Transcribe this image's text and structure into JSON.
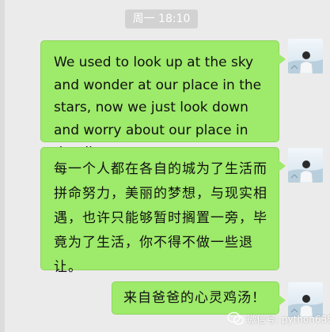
{
  "chat": {
    "timestamp": "周一 18:10",
    "messages": [
      {
        "text": "We used to look up at the sky and wonder at our place in the stars, now we just look down and worry about our place in the dirt.",
        "avatar": "user-avatar-icon"
      },
      {
        "text": "每一个人都在各自的城为了生活而拼命努力，美丽的梦想，与现实相遇，也许只能够暂时搁置一旁，毕竟为了生活，你不得不做一些退让。",
        "avatar": "user-avatar-icon"
      },
      {
        "text": "来自爸爸的心灵鸡汤！",
        "avatar": "user-avatar-icon"
      }
    ]
  },
  "watermark": {
    "label": "微信号: python6359",
    "icon": "wechat-logo-icon"
  },
  "colors": {
    "background": "#ebebeb",
    "bubble": "#9eea6a",
    "timestamp_bg": "#d2d2d2"
  }
}
